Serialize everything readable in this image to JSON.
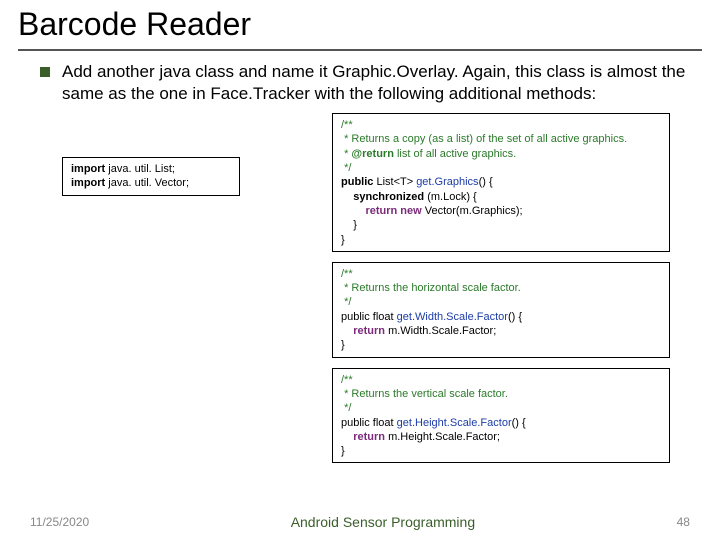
{
  "title": "Barcode Reader",
  "bullet": "Add another java class and name it Graphic.Overlay. Again, this class is almost the same as the one in Face.Tracker with the following additional methods:",
  "imports": {
    "kw": "import",
    "l1": " java. util. List;",
    "l2": " java. util. Vector;"
  },
  "code1": {
    "c1": "/**",
    "c2": " * Returns a copy (as a list) of the set of all active graphics.",
    "c3a": " * ",
    "c3tag": "@return",
    "c3b": " list of all active graphics.",
    "c4": " */",
    "l1a": "public",
    "l1b": " List<T> ",
    "l1c": "get.Graphics",
    "l1d": "() {",
    "l2a": "    synchronized",
    "l2b": " (m.Lock) {",
    "l3a": "        return new ",
    "l3b": "Vector(m.Graphics);",
    "l4": "    }",
    "l5": "}"
  },
  "code2": {
    "c1": "/**",
    "c2": " * Returns the horizontal scale factor.",
    "c3": " */",
    "l1a": "public float ",
    "l1b": "get.Width.Scale.Factor",
    "l1c": "() {",
    "l2a": "    return",
    "l2b": " m.Width.Scale.Factor;",
    "l3": "}"
  },
  "code3": {
    "c1": "/**",
    "c2": " * Returns the vertical scale factor.",
    "c3": " */",
    "l1a": "public float ",
    "l1b": "get.Height.Scale.Factor",
    "l1c": "() {",
    "l2a": "    return",
    "l2b": " m.Height.Scale.Factor;",
    "l3": "}"
  },
  "footer": {
    "left": "11/25/2020",
    "center": "Android Sensor Programming",
    "right": "48"
  }
}
